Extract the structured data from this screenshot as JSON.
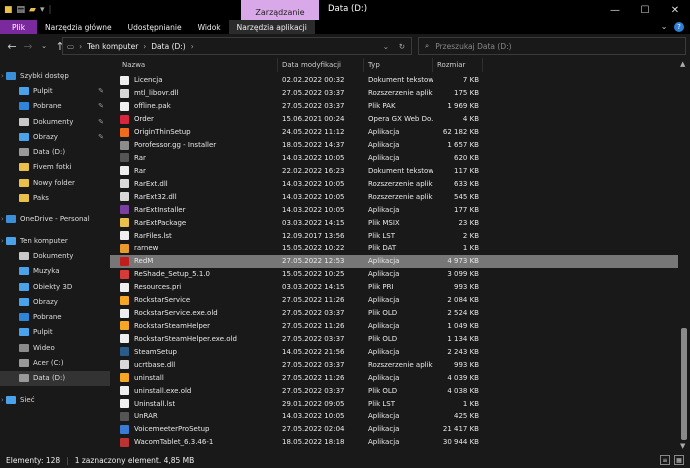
{
  "window": {
    "title": "Data (D:)",
    "manage_tab": "Zarządzanie"
  },
  "ribbon": {
    "tabs": [
      "Plik",
      "Narzędzia główne",
      "Udostępnianie",
      "Widok",
      "Narzędzia aplikacji"
    ],
    "expand_icon": "chevron-down-icon",
    "help_icon": "help-icon"
  },
  "address": {
    "crumbs": [
      "Ten komputer",
      "Data (D:)"
    ],
    "search_placeholder": "Przeszukaj Data (D:)"
  },
  "nav": {
    "items": [
      {
        "label": "Szybki dostęp",
        "indent": 0,
        "icon": "star-icon",
        "color": "#3b8fd8"
      },
      {
        "label": "Pulpit",
        "indent": 1,
        "icon": "desktop-icon",
        "color": "#4aa3ea",
        "pin": true
      },
      {
        "label": "Pobrane",
        "indent": 1,
        "icon": "download-icon",
        "color": "#2f86d9",
        "pin": true
      },
      {
        "label": "Dokumenty",
        "indent": 1,
        "icon": "documents-icon",
        "color": "#c8c8c8",
        "pin": true
      },
      {
        "label": "Obrazy",
        "indent": 1,
        "icon": "pictures-icon",
        "color": "#4aa3ea",
        "pin": true
      },
      {
        "label": "Data (D:)",
        "indent": 1,
        "icon": "drive-icon",
        "color": "#999999"
      },
      {
        "label": "Fivem fotki",
        "indent": 1,
        "icon": "folder-icon",
        "color": "#e8c04a"
      },
      {
        "label": "Nowy folder",
        "indent": 1,
        "icon": "folder-icon",
        "color": "#e8c04a"
      },
      {
        "label": "Paks",
        "indent": 1,
        "icon": "folder-icon",
        "color": "#e8c04a"
      },
      {
        "label": "",
        "indent": 0,
        "icon": "spacer",
        "color": "transparent"
      },
      {
        "label": "OneDrive - Personal",
        "indent": 0,
        "icon": "cloud-icon",
        "color": "#3b8fd8"
      },
      {
        "label": "",
        "indent": 0,
        "icon": "spacer",
        "color": "transparent"
      },
      {
        "label": "Ten komputer",
        "indent": 0,
        "icon": "computer-icon",
        "color": "#4aa3ea"
      },
      {
        "label": "Dokumenty",
        "indent": 1,
        "icon": "documents-icon",
        "color": "#c8c8c8"
      },
      {
        "label": "Muzyka",
        "indent": 1,
        "icon": "music-icon",
        "color": "#4aa3ea"
      },
      {
        "label": "Obiekty 3D",
        "indent": 1,
        "icon": "cube-icon",
        "color": "#4aa3ea"
      },
      {
        "label": "Obrazy",
        "indent": 1,
        "icon": "pictures-icon",
        "color": "#4aa3ea"
      },
      {
        "label": "Pobrane",
        "indent": 1,
        "icon": "download-icon",
        "color": "#2f86d9"
      },
      {
        "label": "Pulpit",
        "indent": 1,
        "icon": "desktop-icon",
        "color": "#4aa3ea"
      },
      {
        "label": "Wideo",
        "indent": 1,
        "icon": "video-icon",
        "color": "#8c8c8c"
      },
      {
        "label": "Acer (C:)",
        "indent": 1,
        "icon": "drive-icon",
        "color": "#999999"
      },
      {
        "label": "Data (D:)",
        "indent": 1,
        "icon": "drive-icon",
        "color": "#999999",
        "selected": true
      },
      {
        "label": "",
        "indent": 0,
        "icon": "spacer",
        "color": "transparent"
      },
      {
        "label": "Sieć",
        "indent": 0,
        "icon": "network-icon",
        "color": "#4aa3ea"
      }
    ]
  },
  "columns": [
    "Nazwa",
    "Data modyfikacji",
    "Typ",
    "Rozmiar"
  ],
  "files": [
    {
      "name": "Licencja",
      "date": "02.02.2022 00:32",
      "type": "Dokument tekstowy",
      "size": "7 KB",
      "icon": "text-file-icon",
      "color": "#eeeeee"
    },
    {
      "name": "mtl_libovr.dll",
      "date": "27.05.2022 03:37",
      "type": "Rozszerzenie aplik...",
      "size": "175 KB",
      "icon": "dll-file-icon",
      "color": "#d8d8d8"
    },
    {
      "name": "offline.pak",
      "date": "27.05.2022 03:37",
      "type": "Plik PAK",
      "size": "1 969 KB",
      "icon": "file-icon",
      "color": "#eeeeee"
    },
    {
      "name": "Order",
      "date": "15.06.2021 00:24",
      "type": "Opera GX Web Do...",
      "size": "4 KB",
      "icon": "opera-icon",
      "color": "#d9263e"
    },
    {
      "name": "OriginThinSetup",
      "date": "24.05.2022 11:12",
      "type": "Aplikacja",
      "size": "62 182 KB",
      "icon": "origin-icon",
      "color": "#f26a1b"
    },
    {
      "name": "Porofessor.gg - Installer",
      "date": "18.05.2022 14:37",
      "type": "Aplikacja",
      "size": "1 657 KB",
      "icon": "porofessor-icon",
      "color": "#8c8c8c"
    },
    {
      "name": "Rar",
      "date": "14.03.2022 10:05",
      "type": "Aplikacja",
      "size": "620 KB",
      "icon": "console-app-icon",
      "color": "#555555"
    },
    {
      "name": "Rar",
      "date": "22.02.2022 16:23",
      "type": "Dokument tekstowy",
      "size": "117 KB",
      "icon": "text-file-icon",
      "color": "#eeeeee"
    },
    {
      "name": "RarExt.dll",
      "date": "14.03.2022 10:05",
      "type": "Rozszerzenie aplik...",
      "size": "633 KB",
      "icon": "dll-file-icon",
      "color": "#d8d8d8"
    },
    {
      "name": "RarExt32.dll",
      "date": "14.03.2022 10:05",
      "type": "Rozszerzenie aplik...",
      "size": "545 KB",
      "icon": "dll-file-icon",
      "color": "#d8d8d8"
    },
    {
      "name": "RarExtInstaller",
      "date": "14.03.2022 10:05",
      "type": "Aplikacja",
      "size": "177 KB",
      "icon": "winrar-icon",
      "color": "#7a3fa0"
    },
    {
      "name": "RarExtPackage",
      "date": "03.03.2022 14:15",
      "type": "Plik MSIX",
      "size": "23 KB",
      "icon": "package-icon",
      "color": "#e8c04a"
    },
    {
      "name": "RarFiles.lst",
      "date": "12.09.2017 13:56",
      "type": "Plik LST",
      "size": "2 KB",
      "icon": "file-icon",
      "color": "#eeeeee"
    },
    {
      "name": "rarnew",
      "date": "15.05.2022 10:22",
      "type": "Plik DAT",
      "size": "1 KB",
      "icon": "dat-file-icon",
      "color": "#e89a2a"
    },
    {
      "name": "RedM",
      "date": "27.05.2022 12:53",
      "type": "Aplikacja",
      "size": "4 973 KB",
      "icon": "redm-icon",
      "color": "#c21d1d",
      "selected": true
    },
    {
      "name": "ReShade_Setup_5.1.0",
      "date": "15.05.2022 10:25",
      "type": "Aplikacja",
      "size": "3 099 KB",
      "icon": "reshade-icon",
      "color": "#d83a3a"
    },
    {
      "name": "Resources.pri",
      "date": "03.03.2022 14:15",
      "type": "Plik PRI",
      "size": "993 KB",
      "icon": "file-icon",
      "color": "#eeeeee"
    },
    {
      "name": "RockstarService",
      "date": "27.05.2022 11:26",
      "type": "Aplikacja",
      "size": "2 084 KB",
      "icon": "rockstar-icon",
      "color": "#f5a623"
    },
    {
      "name": "RockstarService.exe.old",
      "date": "27.05.2022 03:37",
      "type": "Plik OLD",
      "size": "2 524 KB",
      "icon": "file-icon",
      "color": "#eeeeee"
    },
    {
      "name": "RockstarSteamHelper",
      "date": "27.05.2022 11:26",
      "type": "Aplikacja",
      "size": "1 049 KB",
      "icon": "rockstar-icon",
      "color": "#f5a623"
    },
    {
      "name": "RockstarSteamHelper.exe.old",
      "date": "27.05.2022 03:37",
      "type": "Plik OLD",
      "size": "1 134 KB",
      "icon": "file-icon",
      "color": "#eeeeee"
    },
    {
      "name": "SteamSetup",
      "date": "14.05.2022 21:56",
      "type": "Aplikacja",
      "size": "2 243 KB",
      "icon": "steam-icon",
      "color": "#2a5c8a"
    },
    {
      "name": "ucrtbase.dll",
      "date": "27.05.2022 03:37",
      "type": "Rozszerzenie aplik...",
      "size": "993 KB",
      "icon": "dll-file-icon",
      "color": "#d8d8d8"
    },
    {
      "name": "uninstall",
      "date": "27.05.2022 11:26",
      "type": "Aplikacja",
      "size": "4 039 KB",
      "icon": "rockstar-icon",
      "color": "#f5a623"
    },
    {
      "name": "uninstall.exe.old",
      "date": "27.05.2022 03:37",
      "type": "Plik OLD",
      "size": "4 038 KB",
      "icon": "file-icon",
      "color": "#eeeeee"
    },
    {
      "name": "Uninstall.lst",
      "date": "29.01.2022 09:05",
      "type": "Plik LST",
      "size": "1 KB",
      "icon": "file-icon",
      "color": "#eeeeee"
    },
    {
      "name": "UnRAR",
      "date": "14.03.2022 10:05",
      "type": "Aplikacja",
      "size": "425 KB",
      "icon": "console-app-icon",
      "color": "#555555"
    },
    {
      "name": "VoicemeeterProSetup",
      "date": "27.05.2022 02:04",
      "type": "Aplikacja",
      "size": "21 417 KB",
      "icon": "voicemeeter-icon",
      "color": "#3a7bd5"
    },
    {
      "name": "WacomTablet_6.3.46-1",
      "date": "18.05.2022 18:18",
      "type": "Aplikacja",
      "size": "30 944 KB",
      "icon": "wacom-icon",
      "color": "#b33"
    }
  ],
  "status": {
    "count": "Elementy: 128",
    "selection": "1 zaznaczony element. 4,85 MB"
  }
}
